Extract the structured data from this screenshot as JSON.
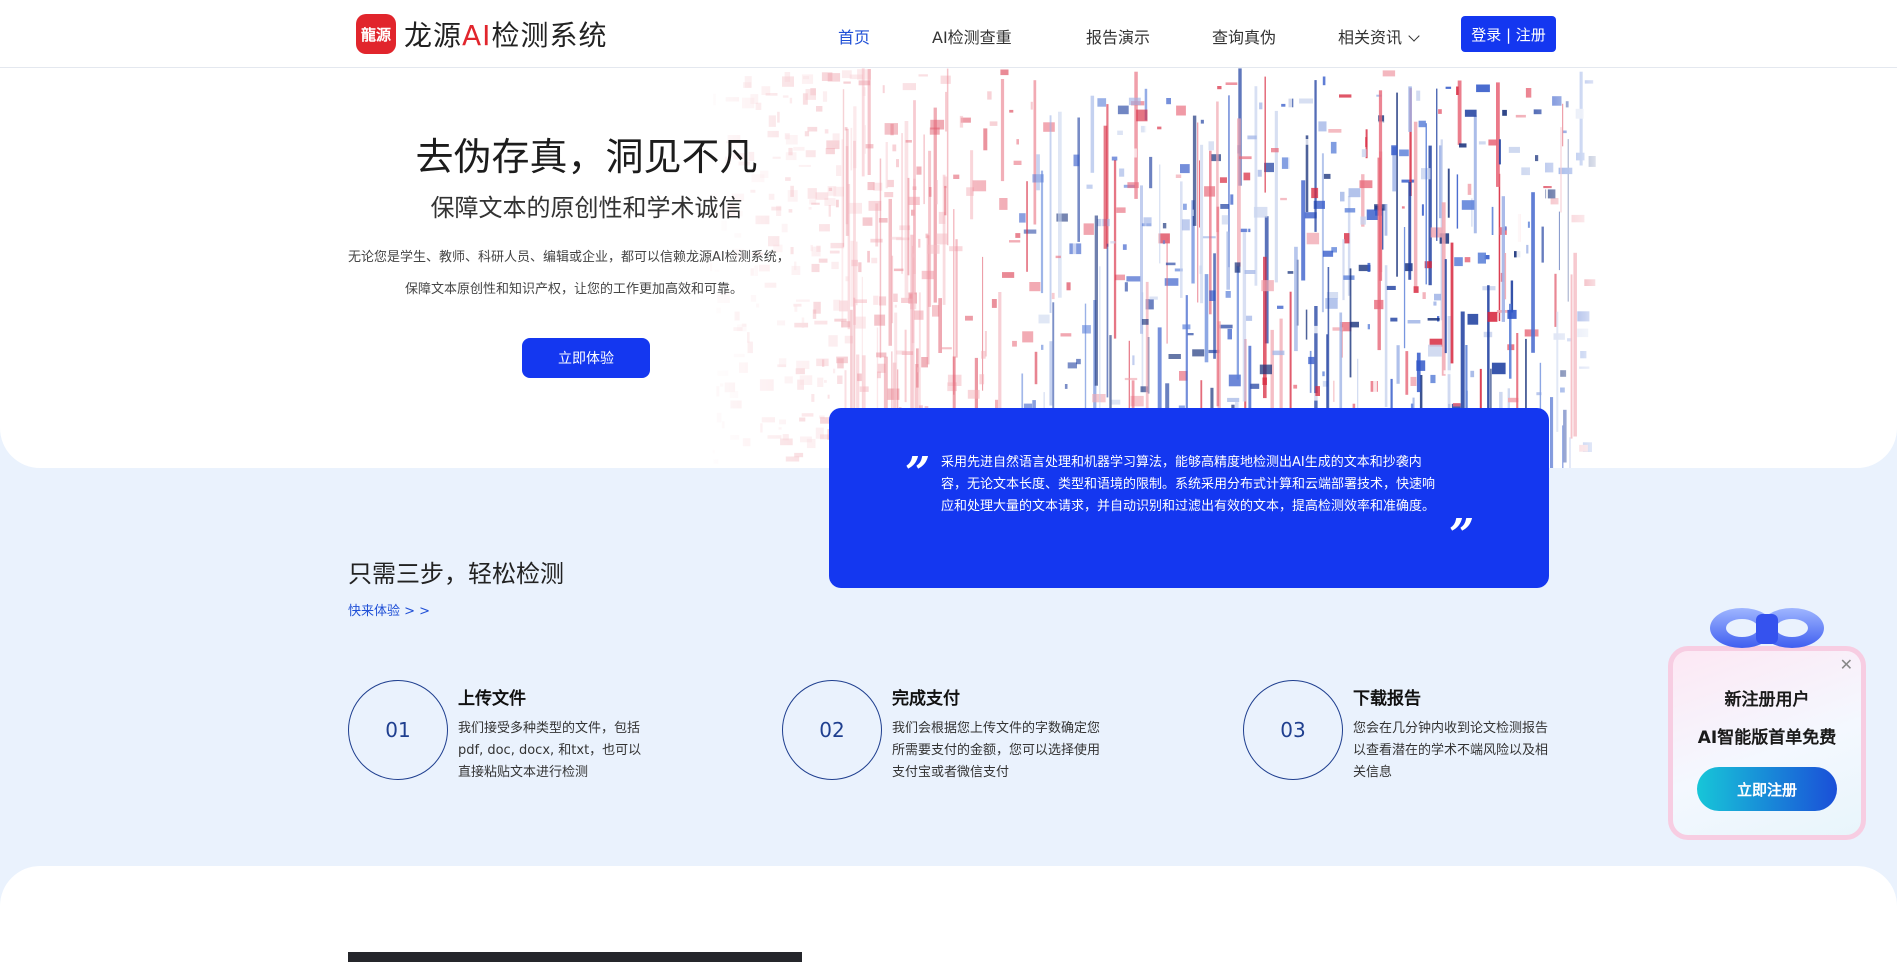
{
  "header": {
    "logo_mark": "龍源",
    "logo_text_pre": "龙源",
    "logo_text_ai": "AI",
    "logo_text_post": "检测系统",
    "nav": [
      {
        "label": "首页",
        "active": true
      },
      {
        "label": "AI检测查重"
      },
      {
        "label": "报告演示"
      },
      {
        "label": "查询真伪"
      },
      {
        "label": "相关资讯"
      }
    ],
    "login_label": "登录 | 注册"
  },
  "hero": {
    "title": "去伪存真，洞见不凡",
    "subtitle": "保障文本的原创性和学术诚信",
    "desc_line1": "无论您是学生、教师、科研人员、编辑或企业，都可以信赖龙源AI检测系统，",
    "desc_line2": "保障文本原创性和知识产权，让您的工作更加高效和可靠。",
    "cta_label": "立即体验"
  },
  "quote": {
    "open_mark": "”",
    "close_mark": "”",
    "text": "采用先进自然语言处理和机器学习算法，能够高精度地检测出AI生成的文本和抄袭内容，无论文本长度、类型和语境的限制。系统采用分布式计算和云端部署技术，快速响应和处理大量的文本请求，并自动识别和过滤出有效的文本，提高检测效率和准确度。"
  },
  "steps": {
    "title": "只需三步，轻松检测",
    "link": "快来体验 > >",
    "items": [
      {
        "num": "01",
        "title": "上传文件",
        "desc": "我们接受多种类型的文件，包括pdf, doc, docx, 和txt，也可以直接粘贴文本进行检测"
      },
      {
        "num": "02",
        "title": "完成支付",
        "desc": "我们会根据您上传文件的字数确定您所需要支付的金额，您可以选择使用支付宝或者微信支付"
      },
      {
        "num": "03",
        "title": "下载报告",
        "desc": "您会在几分钟内收到论文检测报告以查看潜在的学术不端风险以及相关信息"
      }
    ]
  },
  "popup": {
    "line1": "新注册用户",
    "line2": "AI智能版首单免费",
    "button": "立即注册",
    "close": "✕"
  },
  "colors": {
    "accent": "#1437f0",
    "brand_red": "#e1252c",
    "section_bg": "#eaf2fd"
  }
}
